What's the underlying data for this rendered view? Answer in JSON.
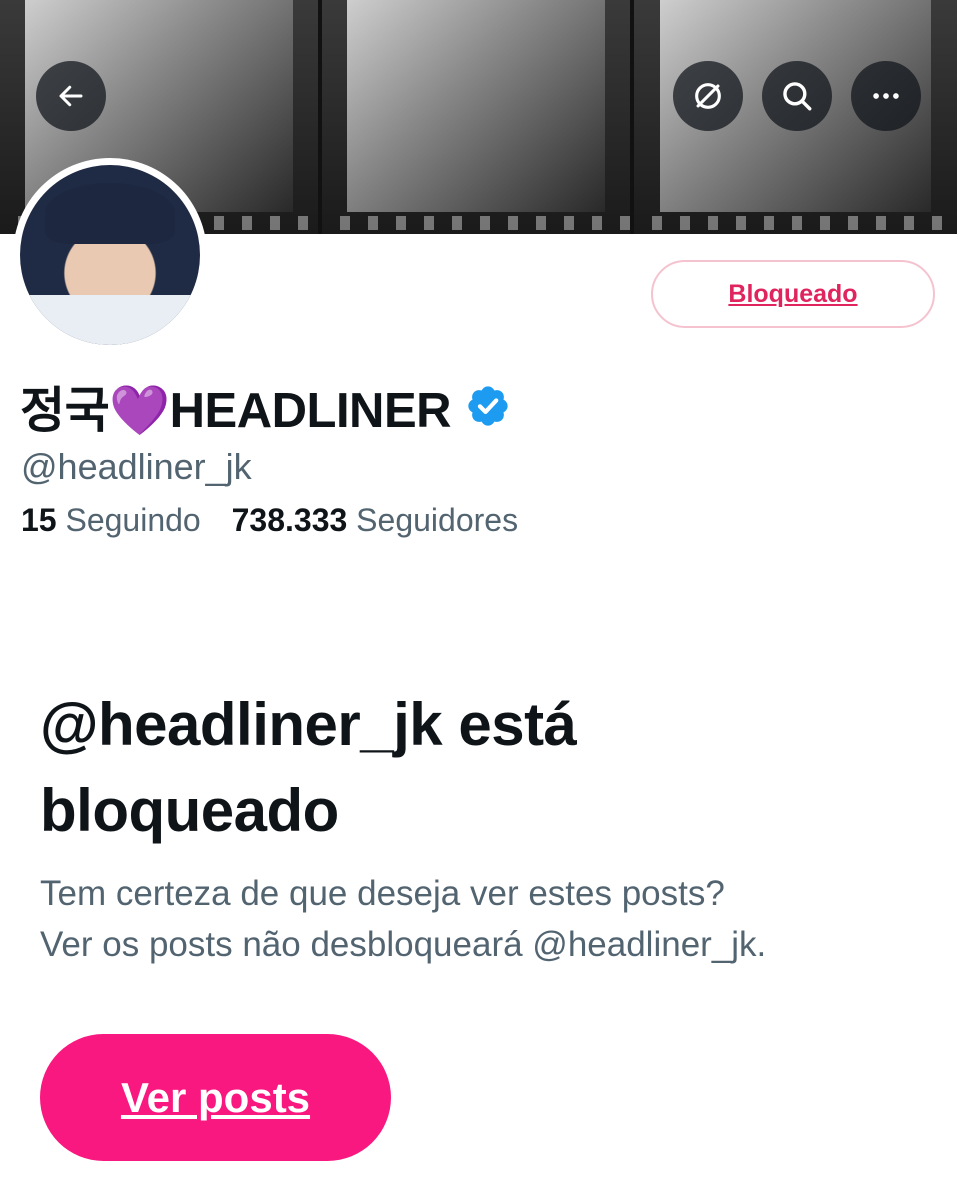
{
  "header": {
    "back_icon": "arrow-left-icon",
    "unfollow_icon": "circle-slash-icon",
    "search_icon": "search-icon",
    "more_icon": "more-horizontal-icon"
  },
  "profile": {
    "display_name": "정국💜HEADLINER",
    "verified_icon": "verified-badge-icon",
    "verified_color": "#1d9bf0",
    "handle": "@headliner_jk",
    "following_count": "15",
    "following_label": "Seguindo",
    "followers_count": "738.333",
    "followers_label": "Seguidores",
    "blocked_button_label": "Bloqueado"
  },
  "blocked_notice": {
    "title": "@headliner_jk está bloqueado",
    "line1": "Tem certeza de que deseja ver estes posts?",
    "line2": "Ver os posts não desbloqueará @headliner_jk.",
    "view_button_label": "Ver posts"
  },
  "colors": {
    "accent_pink": "#f91880",
    "blocked_red": "#e0245e",
    "text_primary": "#0f1419",
    "text_secondary": "#536471"
  }
}
